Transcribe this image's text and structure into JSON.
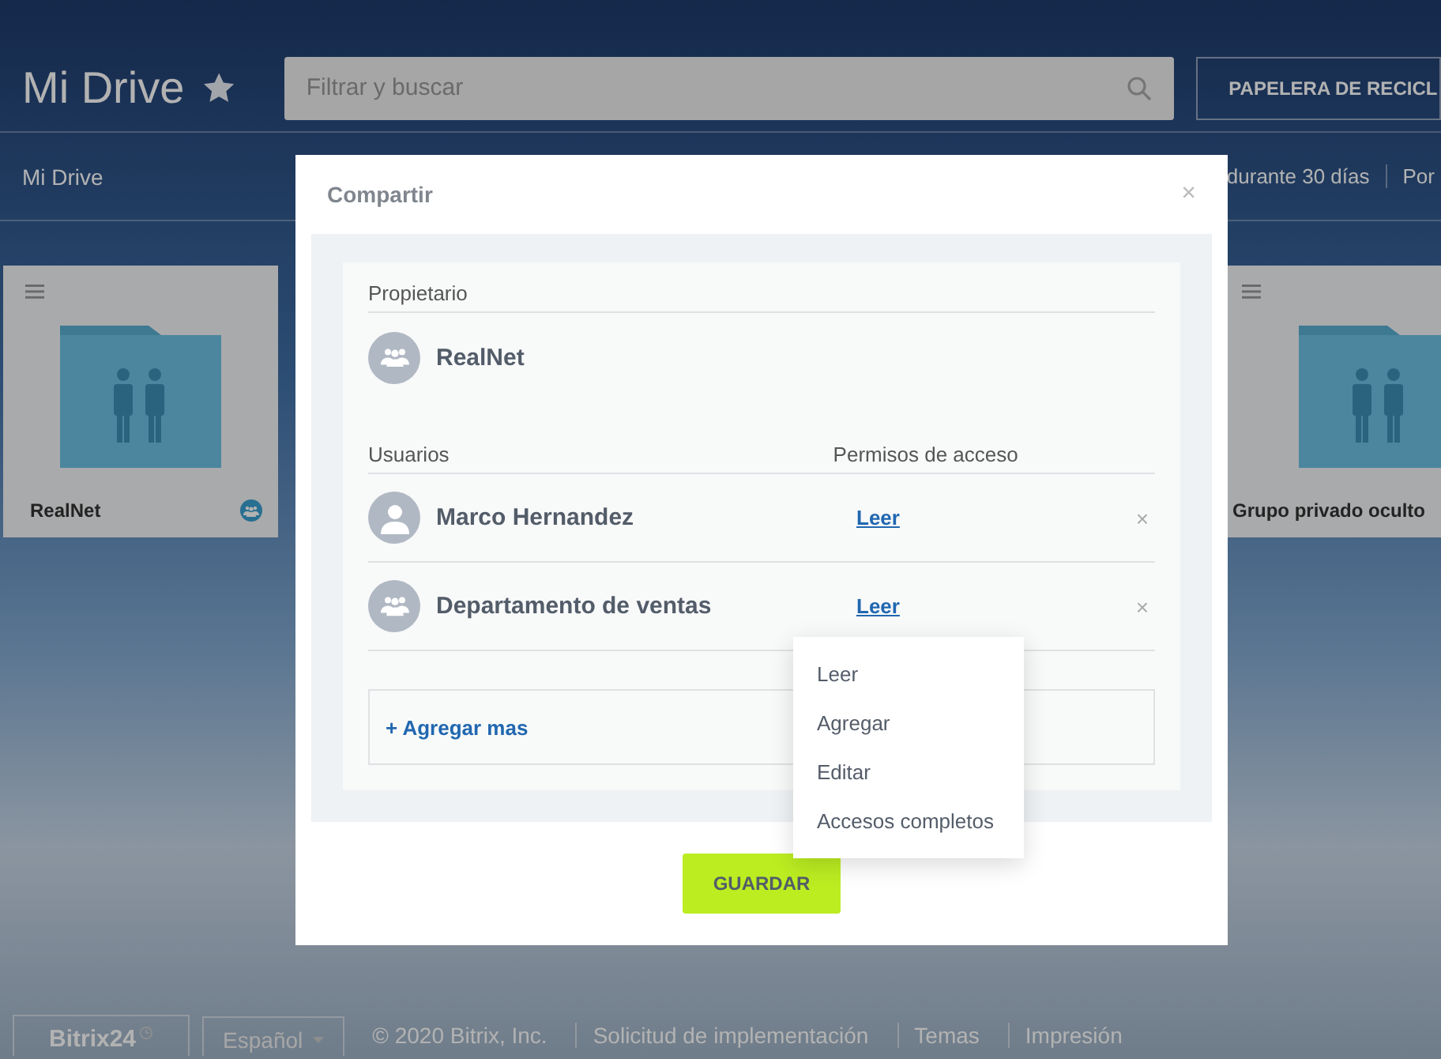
{
  "header": {
    "title": "Mi Drive",
    "search_placeholder": "Filtrar y buscar",
    "recycle_button": "PAPELERA DE RECICL"
  },
  "toolbar": {
    "breadcrumb": "Mi Drive",
    "items": [
      "durante 30 días",
      "Por"
    ]
  },
  "folders": [
    {
      "name": "RealNet",
      "shared": true
    },
    {
      "name": "Grupo privado oculto",
      "shared": false
    }
  ],
  "dialog": {
    "title": "Compartir",
    "close": "×",
    "owner_label": "Propietario",
    "owner": {
      "name": "RealNet",
      "kind": "group"
    },
    "users_label": "Usuarios",
    "permissions_label": "Permisos de acceso",
    "users": [
      {
        "name": "Marco Hernandez",
        "kind": "user",
        "permission": "Leer",
        "remove": "×"
      },
      {
        "name": "Departamento de ventas",
        "kind": "group",
        "permission": "Leer",
        "remove": "×"
      }
    ],
    "add_more": "+ Agregar mas",
    "permission_menu": [
      "Leer",
      "Agregar",
      "Editar",
      "Accesos completos"
    ],
    "save_button": "GUARDAR"
  },
  "footer": {
    "logo": "Bitrix24",
    "language": "Español",
    "copyright": "© 2020 Bitrix, Inc.",
    "links": [
      "Solicitud de implementación",
      "Temas",
      "Impresión"
    ]
  }
}
